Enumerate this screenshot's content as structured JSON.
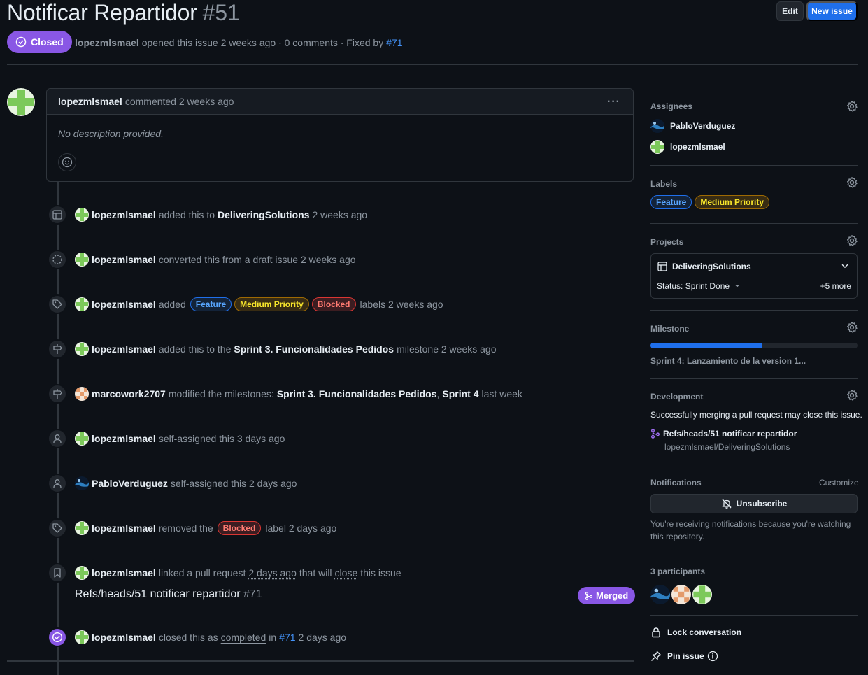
{
  "issue": {
    "title": "Notificar Repartidor",
    "number": "#51",
    "state": "Closed",
    "author": "lopezmlsmael",
    "meta_text": "opened this issue 2 weeks ago · 0 comments · Fixed by",
    "fixed_by": "#71"
  },
  "header_buttons": {
    "edit": "Edit",
    "new_issue": "New issue"
  },
  "comment": {
    "author": "lopezmlsmael",
    "time": "commented 2 weeks ago",
    "body": "No description provided."
  },
  "timeline": {
    "e1": {
      "user": "lopezmlsmael",
      "t1": "added this to",
      "project": "DeliveringSolutions",
      "time": "2 weeks ago",
      "icon": "project-table-icon"
    },
    "e2": {
      "user": "lopezmlsmael",
      "t1": "converted this from a draft issue 2 weeks ago",
      "icon": "draft-circle-icon"
    },
    "e3": {
      "user": "lopezmlsmael",
      "t1": "added",
      "labels": [
        "Feature",
        "Medium Priority",
        "Blocked"
      ],
      "t2": "labels 2 weeks ago",
      "icon": "tag-icon"
    },
    "e4": {
      "user": "lopezmlsmael",
      "t1": "added this to the",
      "milestone": "Sprint 3. Funcionalidades Pedidos",
      "t2": "milestone 2 weeks ago",
      "icon": "milestone-icon"
    },
    "e5": {
      "user": "marcowork2707",
      "t1": "modified the milestones:",
      "m1": "Sprint 3. Funcionalidades Pedidos",
      "comma": ",",
      "m2": "Sprint 4",
      "t2": "last week",
      "icon": "milestone-icon"
    },
    "e6": {
      "user": "lopezmlsmael",
      "t1": "self-assigned this 3 days ago",
      "icon": "person-icon"
    },
    "e7": {
      "user": "PabloVerduguez",
      "t1": "self-assigned this 2 days ago",
      "icon": "person-icon"
    },
    "e8": {
      "user": "lopezmlsmael",
      "t1": "removed the",
      "label": "Blocked",
      "t2": "label 2 days ago",
      "icon": "tag-icon"
    },
    "e9": {
      "user": "lopezmlsmael",
      "t1": "linked a pull request",
      "when": "2 days ago",
      "t2": "that will",
      "close": "close",
      "t3": "this issue",
      "icon": "bookmark-icon"
    },
    "pr": {
      "title": "Refs/heads/51 notificar repartidor",
      "number": "#71",
      "state": "Merged"
    },
    "e10": {
      "user": "lopezmlsmael",
      "t1": "closed this as",
      "completed": "completed",
      "t2": "in",
      "pr": "#71",
      "t3": "2 days ago",
      "icon": "check-circle-icon"
    }
  },
  "sidebar": {
    "assignees": {
      "title": "Assignees",
      "users": [
        "PabloVerduguez",
        "lopezmlsmael"
      ]
    },
    "labels": {
      "title": "Labels",
      "items": [
        "Feature",
        "Medium Priority"
      ]
    },
    "projects": {
      "title": "Projects",
      "name": "DeliveringSolutions",
      "status": "Status: Sprint Done",
      "more": "+5 more"
    },
    "milestone": {
      "title": "Milestone",
      "name": "Sprint 4: Lanzamiento de la version 1...",
      "progress": 0.54
    },
    "development": {
      "title": "Development",
      "text": "Successfully merging a pull request may close this issue.",
      "pr": "Refs/heads/51 notificar repartidor",
      "repo": "lopezmlsmael/DeliveringSolutions"
    },
    "notifications": {
      "title": "Notifications",
      "customize": "Customize",
      "button": "Unsubscribe",
      "text": "You're receiving notifications because you're watching this repository."
    },
    "participants": {
      "title": "3 participants"
    },
    "lock": "Lock conversation",
    "pin": "Pin issue"
  },
  "colors": {
    "accent": "#1f6feb",
    "closed": "#8957e5",
    "bg": "#0d1117",
    "border": "#30363d"
  }
}
